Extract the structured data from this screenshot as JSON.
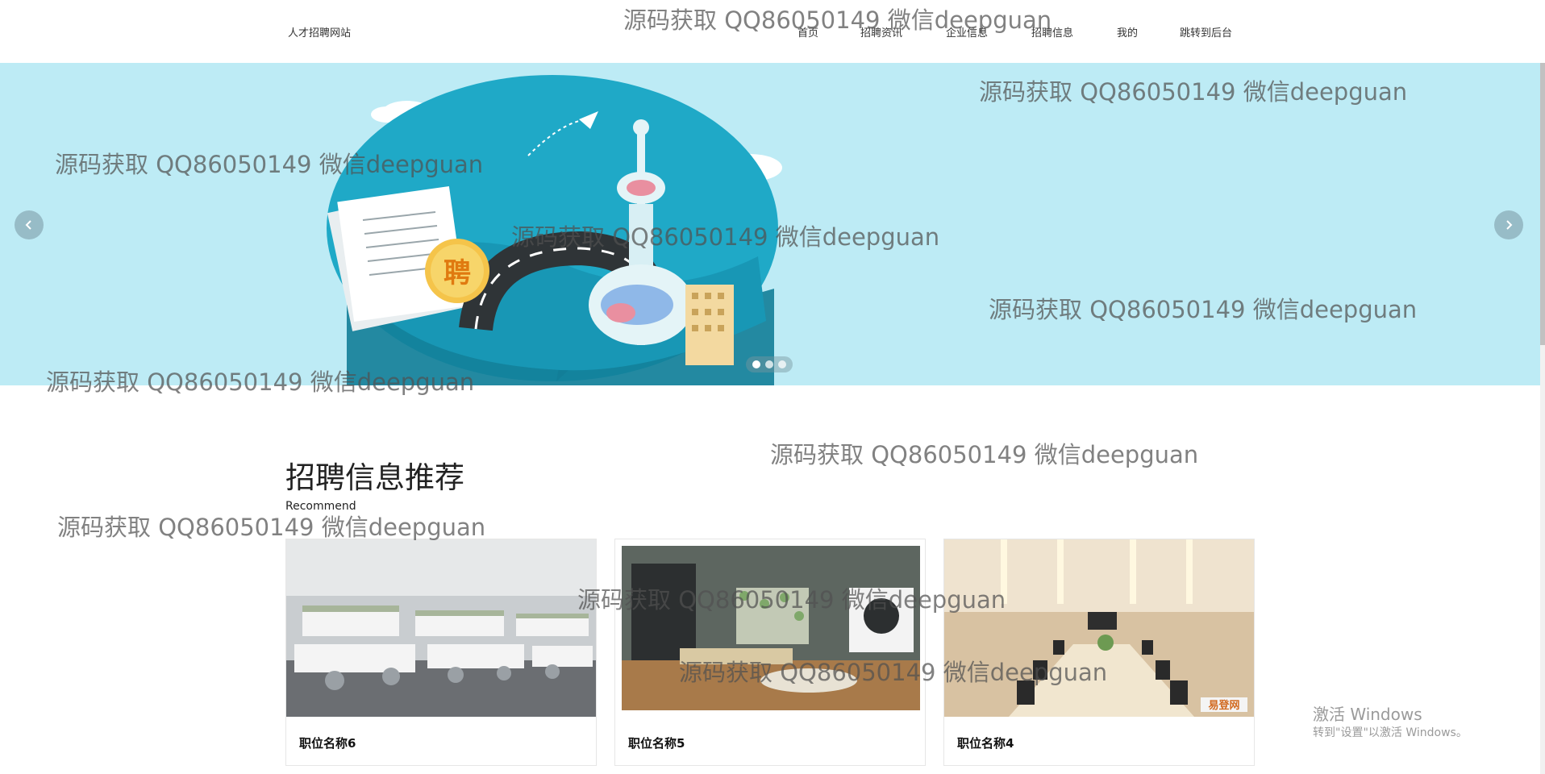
{
  "header": {
    "brand": "人才招聘网站",
    "nav": [
      {
        "label": "首页"
      },
      {
        "label": "招聘资讯"
      },
      {
        "label": "企业信息"
      },
      {
        "label": "招聘信息"
      },
      {
        "label": "我的"
      },
      {
        "label": "跳转到后台"
      }
    ]
  },
  "banner": {
    "badge_text": "聘",
    "slides_total": 3,
    "active_slide": 1,
    "colors": {
      "background": "#bdebf5",
      "bubble": "#1fa9c7"
    }
  },
  "section": {
    "title": "招聘信息推荐",
    "subtitle": "Recommend",
    "cards": [
      {
        "name": "职位名称6",
        "image": "open-office-photo"
      },
      {
        "name": "职位名称5",
        "image": "creative-office-photo"
      },
      {
        "name": "职位名称4",
        "image": "meeting-room-photo",
        "logo_text": "易登网"
      }
    ]
  },
  "watermark": {
    "text": "源码获取 QQ86050149 微信deepguan"
  },
  "os_notice": {
    "title": "激活 Windows",
    "subtitle": "转到\"设置\"以激活 Windows。"
  },
  "icons": [
    "chevron-left-icon",
    "chevron-right-icon"
  ]
}
